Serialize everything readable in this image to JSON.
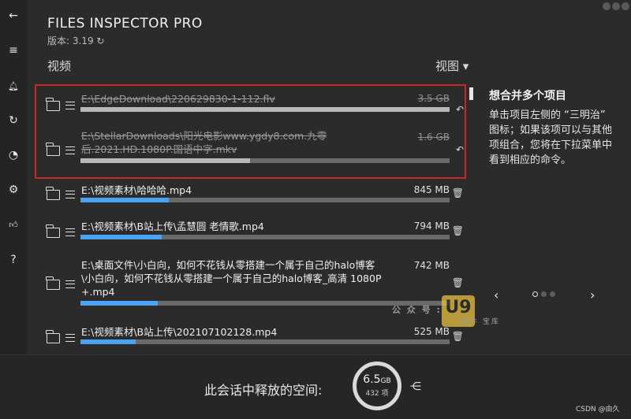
{
  "app": {
    "title": "FILES INSPECTOR PRO",
    "version": "版本: 3.19 ↻"
  },
  "header": {
    "section": "视频",
    "view_label": "视图 ▾"
  },
  "sidebar": {
    "icons": [
      "back-icon",
      "menu-icon",
      "bell-icon",
      "refresh-icon",
      "chart-icon",
      "gear-icon",
      "like-icon",
      "help-icon"
    ],
    "glyphs": [
      "←",
      "≡",
      "🔔︎",
      "↻",
      "◔",
      "⚙",
      "👍︎",
      "?"
    ]
  },
  "files": [
    {
      "path": "E:\\EdgeDownload\\220629830-1-112.flv",
      "size": "3.5 GB",
      "progress": 1.0,
      "state": "done",
      "action": "↶"
    },
    {
      "path_line1": "E:\\StellarDownloads\\阳光电影www.ygdy8.com.九零",
      "path_line2": "后.2021.HD.1080P.国语中字.mkv",
      "size": "1.6 GB",
      "progress": 0.46,
      "state": "done",
      "action": "↶"
    },
    {
      "path": "E:\\视频素材\\哈哈哈.mp4",
      "size": "845 MB",
      "progress": 0.24,
      "state": "pending",
      "action": "🗑︎"
    },
    {
      "path": "E:\\视频素材\\B站上传\\孟慧圆 老情歌.mp4",
      "size": "794 MB",
      "progress": 0.22,
      "state": "pending",
      "action": "🗑︎"
    },
    {
      "path_line1": "E:\\桌面文件\\小白向，如何不花钱从零搭建一个属于自己的halo博客",
      "path_line2": "\\小白向，如何不花钱从零搭建一个属于自己的halo博客_高清 1080P",
      "path_line3": "+.mp4",
      "size": "742 MB",
      "progress": 0.21,
      "state": "pending",
      "action": "🗑︎"
    },
    {
      "path": "E:\\视频素材\\B站上传\\202107102128.mp4",
      "size": "525 MB",
      "progress": 0.15,
      "state": "pending",
      "action": "🗑︎"
    }
  ],
  "tip": {
    "title": "想合并多个项目",
    "body": "单击项目左侧的 “三明治” 图标；如果该项可以与其他项组合，您将在下拉菜单中看到相应的命令。",
    "prev": "‹",
    "next": "›"
  },
  "watermark": {
    "text": "公 众 号 :",
    "logo": "U9",
    "sub": "软件 宝库"
  },
  "footer": {
    "label": "此会话中释放的空间:",
    "size": "6.5",
    "unit": "GB",
    "count": "432 项",
    "share_glyph": "⋲"
  },
  "credit": "CSDN @由久",
  "colors": {
    "progress_active": "#4aa3f0",
    "progress_done": "#b8b8b8",
    "highlight_border": "#c9262c"
  }
}
